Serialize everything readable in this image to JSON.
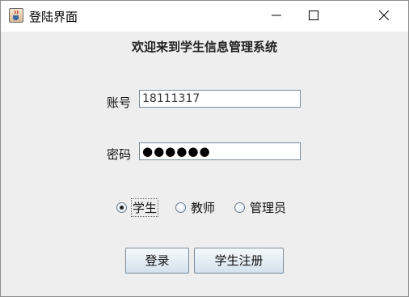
{
  "window": {
    "title": "登陆界面",
    "icons": {
      "app": "java-cup-icon",
      "minimize": "minimize-icon",
      "maximize": "maximize-icon",
      "close": "close-icon"
    }
  },
  "form": {
    "heading": "欢迎来到学生信息管理系统",
    "account_label": "账号",
    "account_value": "18111317",
    "password_label": "密码",
    "password_value": "●●●●●●",
    "roles": [
      {
        "label": "学生",
        "selected": true
      },
      {
        "label": "教师",
        "selected": false
      },
      {
        "label": "管理员",
        "selected": false
      }
    ],
    "login_button": "登录",
    "register_button": "学生注册"
  }
}
